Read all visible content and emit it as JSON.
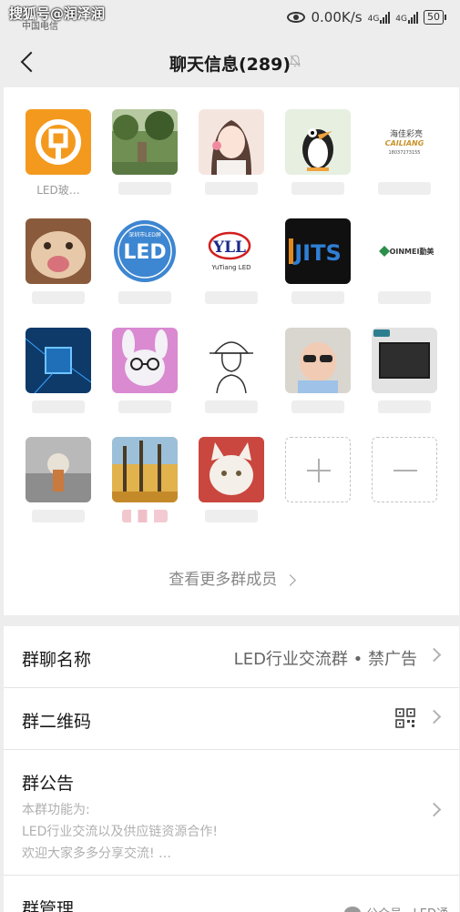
{
  "watermark_top": "搜狐号@润泽润",
  "status": {
    "carrier": "中国电信",
    "speed": "0.00K/s",
    "net1": "4G",
    "net2": "4G",
    "battery": "50"
  },
  "header": {
    "title": "聊天信息(289)"
  },
  "members": [
    {
      "name": "LED玻…",
      "avatar": "bank-logo"
    },
    {
      "name": "",
      "avatar": "garden-photo"
    },
    {
      "name": "",
      "avatar": "girl-illustration"
    },
    {
      "name": "",
      "avatar": "penguin-cartoon"
    },
    {
      "name": "",
      "avatar": "cailiang-logo",
      "logo_text": "海佳彩亮",
      "logo_sub": "CAILIANG",
      "logo_num": "18037273155"
    },
    {
      "name": "",
      "avatar": "cat-face"
    },
    {
      "name": "",
      "avatar": "led-badge",
      "logo_text": "LED",
      "logo_sub": "深圳市LED屏"
    },
    {
      "name": "",
      "avatar": "yll-logo",
      "logo_text": "YLL",
      "logo_sub": "YuTiang LED"
    },
    {
      "name": "",
      "avatar": "jits-logo",
      "logo_text": "JITS"
    },
    {
      "name": "",
      "avatar": "qinmei-logo",
      "logo_text": "OINMEI勤美"
    },
    {
      "name": "",
      "avatar": "chip-photo"
    },
    {
      "name": "",
      "avatar": "bunny-glasses"
    },
    {
      "name": "",
      "avatar": "hat-sketch"
    },
    {
      "name": "",
      "avatar": "baby-sunglasses"
    },
    {
      "name": "",
      "avatar": "panel-photo"
    },
    {
      "name": "",
      "avatar": "foggy-photo"
    },
    {
      "name": "",
      "avatar": "forest-photo"
    },
    {
      "name": "",
      "avatar": "white-cat"
    }
  ],
  "more_members": "查看更多群成员",
  "rows": {
    "group_name": {
      "label": "群聊名称",
      "value": "LED行业交流群 • 禁广告"
    },
    "qr": {
      "label": "群二维码"
    },
    "notice": {
      "label": "群公告",
      "line1": "本群功能为:",
      "line2": "LED行业交流以及供应链资源合作!",
      "line3": "欢迎大家多多分享交流! …"
    },
    "manage": {
      "label": "群管理"
    }
  },
  "watermark_bottom": "公众号 · LED通"
}
